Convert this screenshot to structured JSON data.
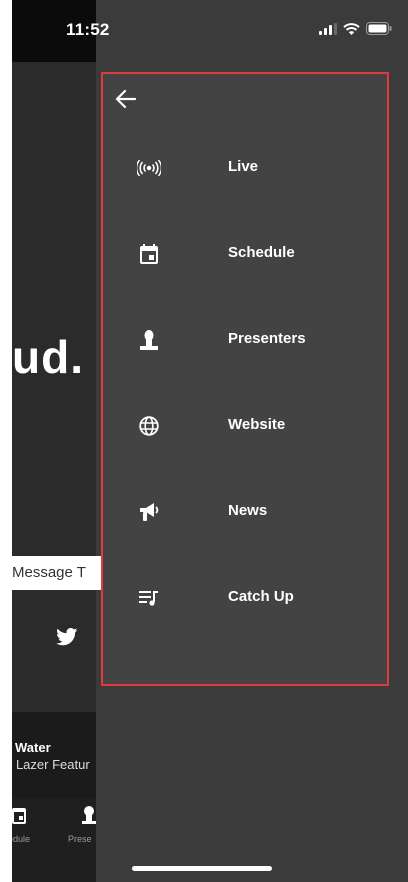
{
  "status_bar": {
    "time": "11:52",
    "icons": [
      "signal-icon",
      "wifi-icon",
      "battery-icon"
    ]
  },
  "background": {
    "title_fragment": "ud.",
    "message_placeholder": "Message T",
    "now_playing": {
      "title": "Water",
      "subtitle": "r Lazer Featur"
    },
    "tabs": [
      {
        "label": "edule",
        "icon": "calendar-icon"
      },
      {
        "label": "Prese",
        "icon": "person-icon"
      }
    ]
  },
  "drawer": {
    "back_icon": "arrow-left-icon",
    "items": [
      {
        "label": "Live",
        "icon": "broadcast-icon"
      },
      {
        "label": "Schedule",
        "icon": "calendar-icon"
      },
      {
        "label": "Presenters",
        "icon": "person-icon"
      },
      {
        "label": "Website",
        "icon": "globe-icon"
      },
      {
        "label": "News",
        "icon": "megaphone-icon"
      },
      {
        "label": "Catch Up",
        "icon": "playlist-icon"
      }
    ]
  },
  "colors": {
    "drawer_background": "#434343",
    "drawer_border": "#e03a3e",
    "text": "#ffffff"
  }
}
